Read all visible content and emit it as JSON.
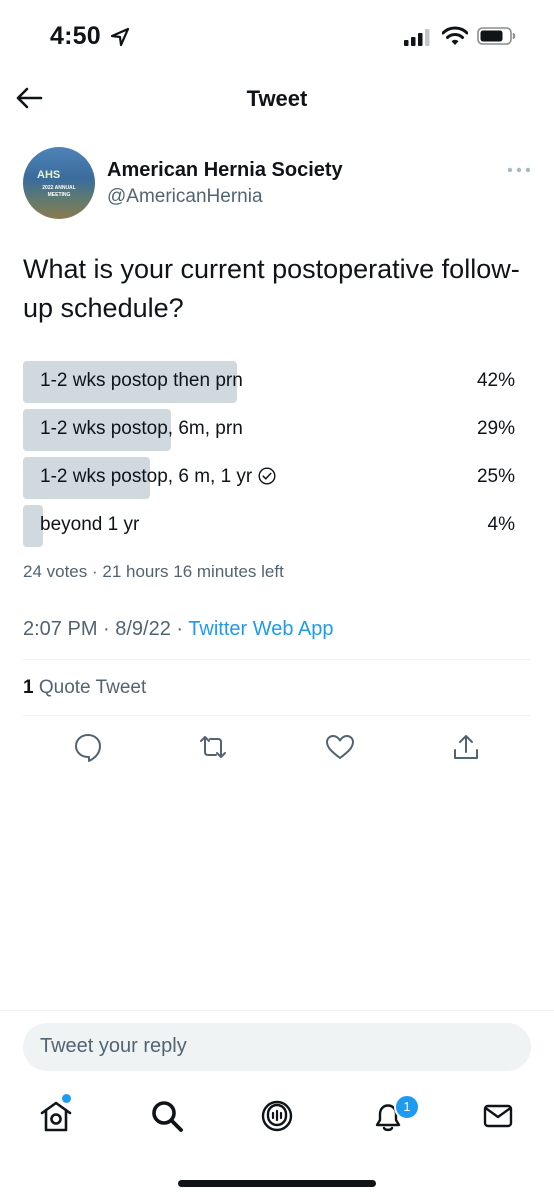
{
  "status_bar": {
    "time": "4:50"
  },
  "header": {
    "title": "Tweet"
  },
  "author": {
    "display_name": "American Hernia Society",
    "handle": "@AmericanHernia",
    "avatar_text": {
      "logo": "AHS",
      "line1": "2022 ANNUAL",
      "line2": "MEETING"
    }
  },
  "tweet": {
    "text": "What is your current postoperative follow-up schedule?"
  },
  "poll": {
    "options": [
      {
        "label": "1-2 wks postop then prn",
        "percent": "42%",
        "fraction": 0.42
      },
      {
        "label": "1-2 wks postop, 6m, prn",
        "percent": "29%",
        "fraction": 0.29
      },
      {
        "label": "1-2 wks postop, 6 m, 1 yr",
        "percent": "25%",
        "fraction": 0.25,
        "selected": true
      },
      {
        "label": "beyond 1 yr",
        "percent": "4%",
        "fraction": 0.04
      }
    ],
    "meta": "24 votes · 21 hours 16 minutes left"
  },
  "timestamp": {
    "time_date": "2:07 PM · 8/9/22 · ",
    "source": "Twitter Web App"
  },
  "engagement": {
    "quote_count": "1",
    "quote_label": " Quote Tweet"
  },
  "actions": [
    "reply-icon",
    "retweet-icon",
    "like-icon",
    "share-icon"
  ],
  "reply": {
    "placeholder": "Tweet your reply"
  },
  "tab_bar": {
    "tabs": [
      "home-icon",
      "search-icon",
      "spaces-icon",
      "notifications-icon",
      "messages-icon"
    ],
    "notification_count": "1"
  },
  "colors": {
    "accent": "#1d9bf0",
    "poll_bar": "#cfd9de",
    "text": "#0f1419",
    "secondary": "#536471"
  }
}
